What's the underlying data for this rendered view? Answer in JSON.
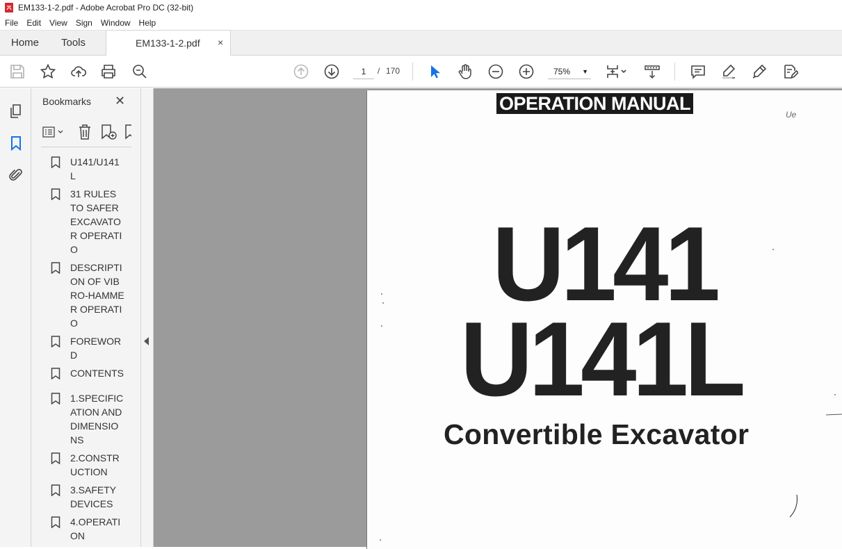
{
  "window": {
    "title": "EM133-1-2.pdf - Adobe Acrobat Pro DC (32-bit)"
  },
  "menu": [
    "File",
    "Edit",
    "View",
    "Sign",
    "Window",
    "Help"
  ],
  "tabs": {
    "home": "Home",
    "tools": "Tools",
    "document": "EM133-1-2.pdf",
    "close_glyph": "×"
  },
  "toolbar": {
    "current_page": "1",
    "page_separator": "/",
    "page_count": "170",
    "zoom": "75%"
  },
  "bookmarks_panel": {
    "title": "Bookmarks",
    "items": [
      "U141/U141L",
      "31 RULES TO SAFER EXCAVATOR OPERATIO",
      "DESCRIPTION OF VIBRO-HAMMER OPERATIO",
      "FOREWORD",
      "CONTENTS",
      "1.SPECIFICATION AND DIMENSIONS",
      "2.CONSTRUCTION",
      "3.SAFETY DEVICES",
      "4.OPERATION"
    ]
  },
  "document_page": {
    "header_banner": "OPERATION MANUAL",
    "model_line_1": "U141",
    "model_line_2": "U141L",
    "subtitle": "Convertible Excavator",
    "handwritten_mark": "Ue"
  },
  "colors": {
    "accent_blue": "#1473e6",
    "canvas_gray": "#9b9b9b",
    "pdf_red": "#d7282f"
  }
}
